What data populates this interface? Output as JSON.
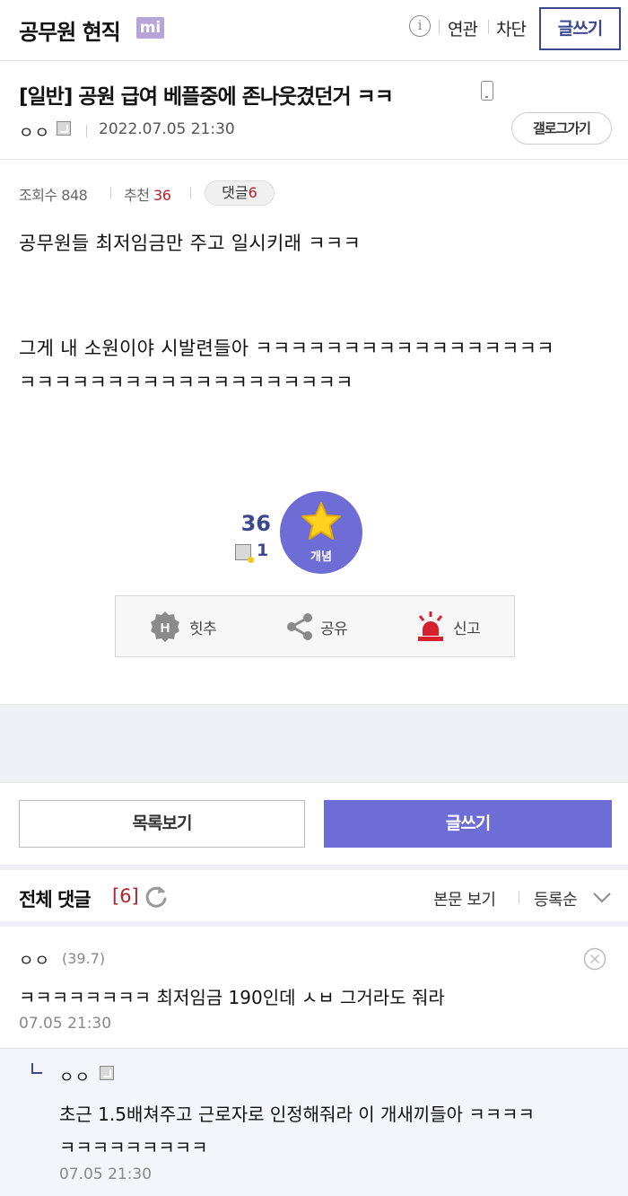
{
  "header": {
    "gallery_name": "공무원 현직",
    "minor_badge": "mi",
    "info_icon_glyph": "i",
    "related_label": "연관",
    "block_label": "차단",
    "write_label": "글쓰기"
  },
  "post": {
    "title": "[일반] 공원 급여 베플중에 존나웃겼던거 ㅋㅋ",
    "author": "ㅇㅇ",
    "date": "2022.07.05 21:30",
    "gallery_go_label": "갤로그가기",
    "views_label": "조회수",
    "views": "848",
    "recommend_label": "추천",
    "recommend": "36",
    "comment_label": "댓글",
    "comment_count": "6",
    "body_lines": [
      "공무원들 최저임금만 주고 일시키래 ㅋㅋㅋ",
      "그게 내 소원이야 시발련들아 ㅋㅋㅋㅋㅋㅋㅋㅋㅋㅋㅋㅋㅋㅋㅋㅋㅋ",
      "ㅋㅋㅋㅋㅋㅋㅋㅋㅋㅋㅋㅋㅋㅋㅋㅋㅋㅋㅋ"
    ],
    "vote_count": "36",
    "fixed_vote_count": "1",
    "concept_label": "개념",
    "actions": {
      "hit_label": "힛추",
      "share_label": "공유",
      "report_label": "신고"
    }
  },
  "buttons": {
    "list_label": "목록보기",
    "write_label": "글쓰기"
  },
  "comments_section": {
    "title": "전체 댓글",
    "count": "[6]",
    "view_body_label": "본문 보기",
    "sort_label": "등록순"
  },
  "comments": [
    {
      "nick": "ㅇㅇ",
      "ip": "(39.7)",
      "text": "ㅋㅋㅋㅋㅋㅋㅋㅋ 최저임금 190인데 ㅅㅂ 그거라도 줘라",
      "date": "07.05 21:30"
    }
  ],
  "reply": {
    "nick": "ㅇㅇ",
    "text_lines": [
      "초근 1.5배쳐주고 근로자로 인정해줘라 이 개새끼들아 ㅋㅋㅋㅋ",
      "ㅋㅋㅋㅋㅋㅋㅋㅋㅋ"
    ],
    "date": "07.05 21:30"
  },
  "colors": {
    "accent": "#6e6dd6",
    "navy": "#3b4890",
    "red": "#b5222a",
    "band": "#eef0f5"
  }
}
